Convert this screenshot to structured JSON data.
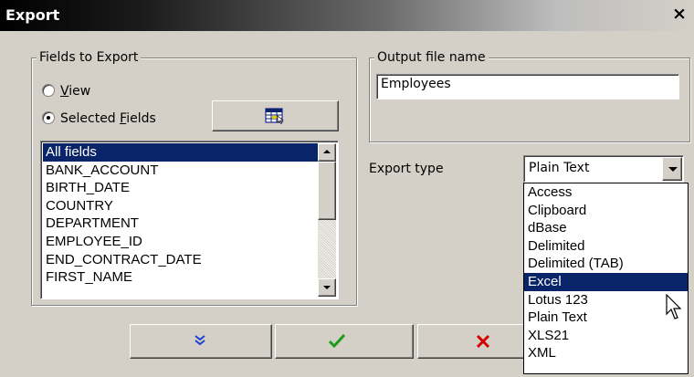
{
  "window": {
    "title": "Export",
    "close_glyph": "×"
  },
  "fields_group": {
    "legend": "Fields to Export",
    "radio_view": {
      "prefix": "",
      "mnemonic": "V",
      "suffix": "iew",
      "checked": false
    },
    "radio_selected": {
      "prefix": "Selected ",
      "mnemonic": "F",
      "suffix": "ields",
      "checked": true
    },
    "select_fields_icon": "field-grid-icon",
    "fields_list": {
      "items": [
        "All fields",
        "BANK_ACCOUNT",
        "BIRTH_DATE",
        "COUNTRY",
        "DEPARTMENT",
        "EMPLOYEE_ID",
        "END_CONTRACT_DATE",
        "FIRST_NAME"
      ],
      "selected_index": 0
    }
  },
  "output_group": {
    "legend": "Output file name",
    "file_name_value": "Employees"
  },
  "export_type": {
    "label": "Export type",
    "selected_value": "Plain Text",
    "options": [
      "Access",
      "Clipboard",
      "dBase",
      "Delimited",
      "Delimited (TAB)",
      "Excel",
      "Lotus 123",
      "Plain Text",
      "XLS21",
      "XML"
    ],
    "highlighted_index": 5
  },
  "buttons": {
    "more_icon": "double-chevron-down-icon",
    "ok_icon": "checkmark-icon",
    "cancel_icon": "x-icon"
  },
  "colors": {
    "selection": "#0a246a",
    "face": "#d4d0c8",
    "ok_green": "#1e9a1e",
    "cancel_red": "#d40000",
    "more_blue": "#1a3fd6"
  }
}
